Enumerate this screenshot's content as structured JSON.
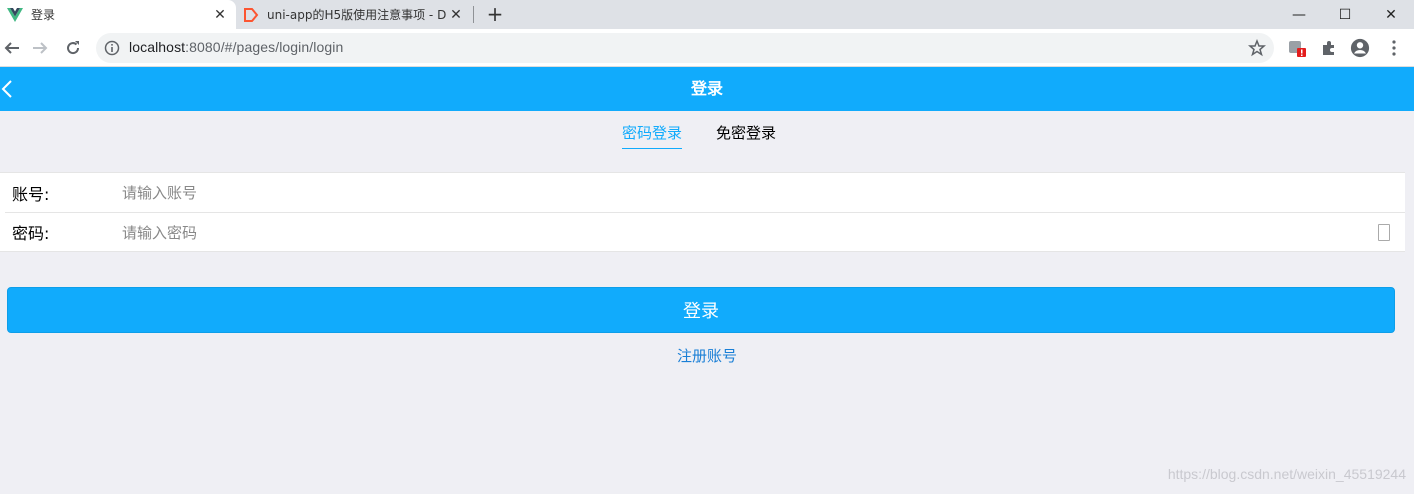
{
  "browser": {
    "tabs": [
      {
        "title": "登录",
        "active": true,
        "favicon": "vue-logo-icon"
      },
      {
        "title": "uni-app的H5版使用注意事项 - D",
        "active": false,
        "favicon": "csdn-logo-icon"
      }
    ],
    "close_glyph": "✕",
    "new_tab_glyph": "+",
    "window_controls": {
      "minimize": "—",
      "maximize": "☐",
      "close": "✕"
    },
    "url_host": "localhost",
    "url_rest": ":8080/#/pages/login/login",
    "colors": {
      "tabstrip": "#dee1e6",
      "omnibox": "#f1f3f4",
      "extension_badge": "#e31d1d"
    }
  },
  "app": {
    "title": "登录",
    "login_tabs": [
      {
        "label": "密码登录",
        "active": true
      },
      {
        "label": "免密登录",
        "active": false
      }
    ],
    "fields": {
      "account": {
        "label": "账号:",
        "placeholder": "请输入账号"
      },
      "password": {
        "label": "密码:",
        "placeholder": "请输入密码"
      }
    },
    "login_button": "登录",
    "register_link": "注册账号",
    "colors": {
      "primary": "#11abfc",
      "background": "#efeff4",
      "link": "#1a7fd6"
    }
  },
  "watermark": "https://blog.csdn.net/weixin_45519244"
}
